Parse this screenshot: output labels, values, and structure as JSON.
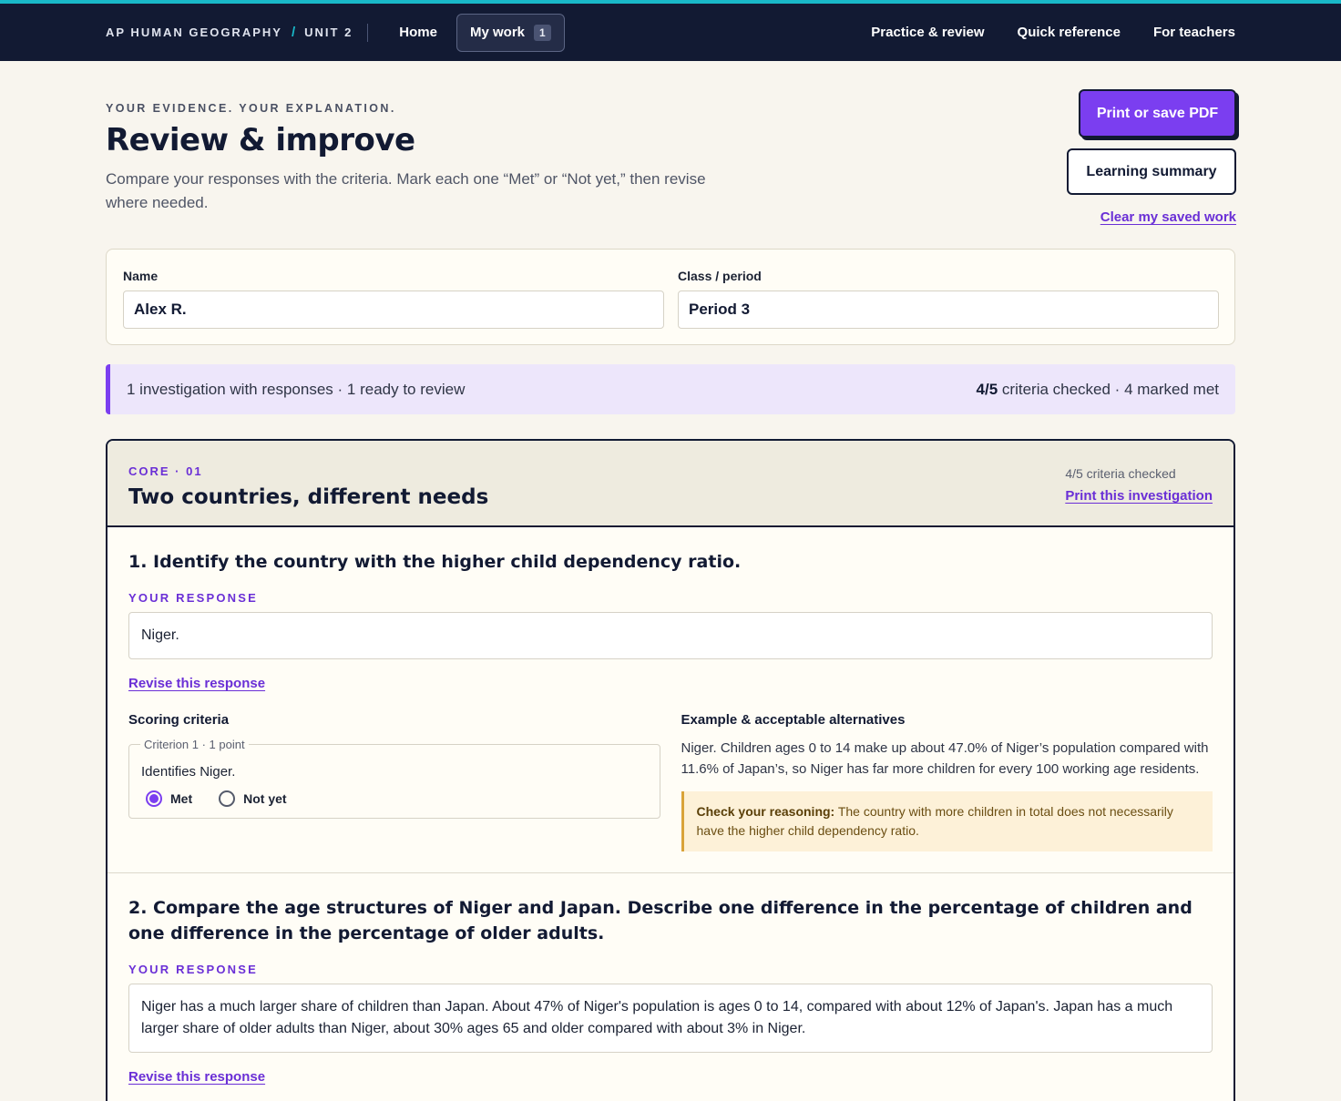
{
  "nav": {
    "course": "AP HUMAN GEOGRAPHY",
    "sep": "/",
    "unit": "UNIT 2",
    "home": "Home",
    "mywork": "My work",
    "mywork_count": "1",
    "right": [
      "Practice & review",
      "Quick reference",
      "For teachers"
    ]
  },
  "header": {
    "eyebrow": "YOUR EVIDENCE. YOUR EXPLANATION.",
    "title": "Review & improve",
    "subtitle": "Compare your responses with the criteria. Mark each one “Met” or “Not yet,” then revise where needed."
  },
  "actions": {
    "print": "Print or save PDF",
    "summary": "Learning summary",
    "clear": "Clear my saved work"
  },
  "student": {
    "name_label": "Name",
    "name_value": "Alex R.",
    "class_label": "Class / period",
    "class_value": "Period 3"
  },
  "status": {
    "left": "1 investigation with responses · 1 ready to review",
    "right_bold": "4/5",
    "right_rest": " criteria checked · 4 marked met"
  },
  "investigation": {
    "code": "CORE · 01",
    "title": "Two countries, different needs",
    "checked": "4/5 criteria checked",
    "print": "Print this investigation",
    "questions": [
      {
        "title": "1. Identify the country with the higher child dependency ratio.",
        "response_label": "YOUR RESPONSE",
        "response": "Niger.",
        "revise": "Revise this response",
        "criteria_title": "Scoring criteria",
        "criterion_legend": "Criterion 1 · 1 point",
        "criterion_text": "Identifies Niger.",
        "met": "Met",
        "notyet": "Not yet",
        "selected": "Met",
        "example_title": "Example & acceptable alternatives",
        "example_text": "Niger. Children ages 0 to 14 make up about 47.0% of Niger’s population compared with 11.6% of Japan’s, so Niger has far more children for every 100 working age residents.",
        "reason_bold": "Check your reasoning:",
        "reason_text": " The country with more children in total does not necessarily have the higher child dependency ratio."
      },
      {
        "title": "2. Compare the age structures of Niger and Japan. Describe one difference in the percentage of children and one difference in the percentage of older adults.",
        "response_label": "YOUR RESPONSE",
        "response": "Niger has a much larger share of children than Japan. About 47% of Niger's population is ages 0 to 14, compared with about 12% of Japan's. Japan has a much larger share of older adults than Niger, about 30% ages 65 and older compared with about 3% in Niger.",
        "revise": "Revise this response"
      }
    ]
  }
}
